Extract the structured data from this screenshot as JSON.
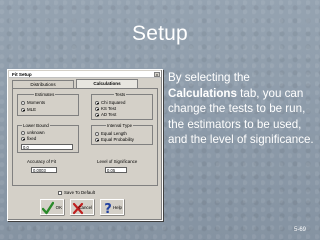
{
  "slide": {
    "title": "Setup",
    "text_before": "By selecting the ",
    "text_bold": "Calculations",
    "text_after": " tab, you can change the tests to be run, the estimators to be used, and the level of significance.",
    "page_number": "5-69"
  },
  "dialog": {
    "title": "Fit Setup",
    "close_label": "x",
    "tabs": [
      {
        "label": "Distributions",
        "active": false
      },
      {
        "label": "Calculations",
        "active": true
      }
    ],
    "estimates": {
      "title": "Estimates",
      "options": [
        {
          "label": "Moments",
          "selected": false
        },
        {
          "label": "MLE",
          "selected": true
        }
      ]
    },
    "tests": {
      "title": "Tests",
      "options": [
        {
          "label": "Chi Squared",
          "selected": true
        },
        {
          "label": "KS Test",
          "selected": true
        },
        {
          "label": "AD Test",
          "selected": true
        }
      ]
    },
    "lower_bound": {
      "title": "Lower Bound",
      "options": [
        {
          "label": "unknown",
          "selected": false
        },
        {
          "label": "fixed",
          "selected": true
        }
      ],
      "value": "0.0"
    },
    "interval_type": {
      "title": "Interval Type",
      "options": [
        {
          "label": "Equal Length",
          "selected": false
        },
        {
          "label": "Equal Probability",
          "selected": true
        }
      ]
    },
    "accuracy": {
      "label": "Accuracy of Fit",
      "value": "0.0003"
    },
    "significance": {
      "label": "Level of Significance",
      "value": "0.05"
    },
    "save_default": {
      "label": "Save To Default",
      "checked": false
    },
    "buttons": {
      "ok": "OK",
      "cancel": "Cancel",
      "help": "Help"
    }
  },
  "colors": {
    "slide_background": "#8c9aa8",
    "dialog_face": "#d4d0c8",
    "ok_check": "#2a8a2a",
    "cancel_x": "#c02020"
  }
}
